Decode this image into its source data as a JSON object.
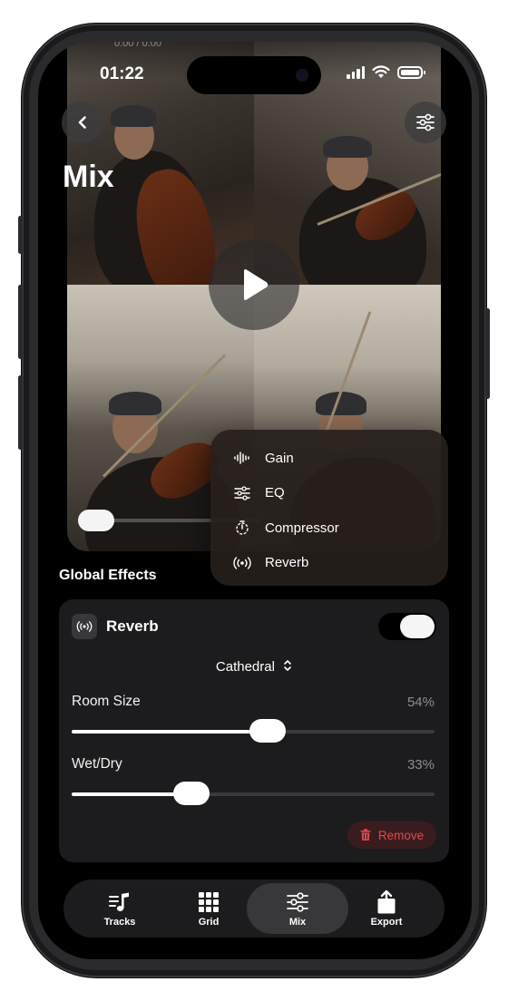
{
  "status": {
    "time": "01:22"
  },
  "video": {
    "timecode": "0:00 / 0:00"
  },
  "header": {
    "title": "Mix"
  },
  "effects_menu": {
    "items": [
      {
        "label": "Gain",
        "icon": "waveform-icon"
      },
      {
        "label": "EQ",
        "icon": "eq-sliders-icon"
      },
      {
        "label": "Compressor",
        "icon": "timer-icon"
      },
      {
        "label": "Reverb",
        "icon": "broadcast-icon"
      }
    ]
  },
  "global_effects": {
    "title": "Global Effects",
    "effect": {
      "name": "Reverb",
      "enabled": true,
      "preset": "Cathedral",
      "params": [
        {
          "label": "Room Size",
          "value": "54%",
          "fraction": 0.54
        },
        {
          "label": "Wet/Dry",
          "value": "33%",
          "fraction": 0.33
        }
      ],
      "remove_label": "Remove"
    }
  },
  "tabbar": {
    "tabs": [
      {
        "label": "Tracks",
        "active": false
      },
      {
        "label": "Grid",
        "active": false
      },
      {
        "label": "Mix",
        "active": true
      },
      {
        "label": "Export",
        "active": false
      }
    ]
  },
  "colors": {
    "accent_remove": "#e0484d",
    "card_bg": "#1c1c1e",
    "screen_bg": "#000000"
  }
}
